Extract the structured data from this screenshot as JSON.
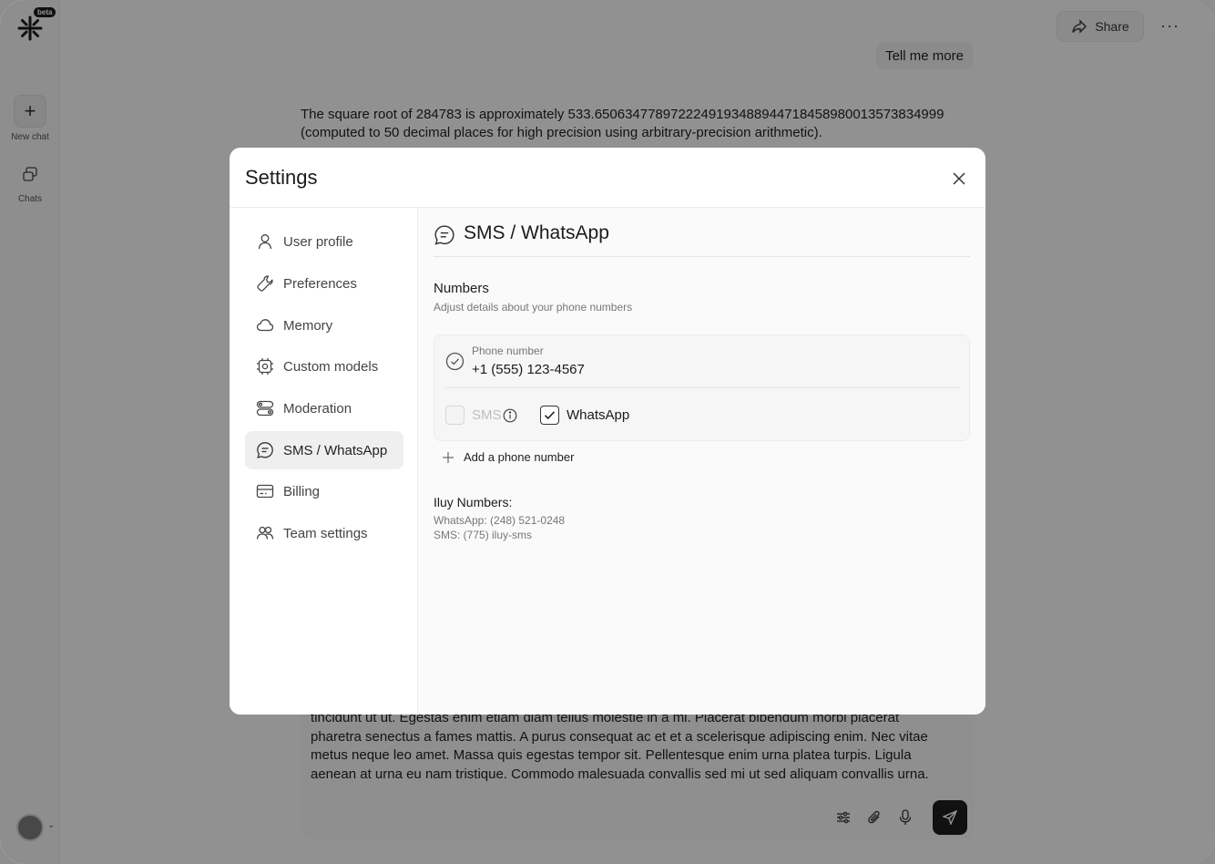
{
  "app": {
    "badge": "beta",
    "rail": {
      "new_chat": "New chat",
      "chats": "Chats"
    },
    "header": {
      "share": "Share"
    },
    "user_message": "Tell me more",
    "assistant_answer": "The square root of 284783 is approximately 533.65063477897222491934889447184589800135738349​99 (computed to 50 decimal places for high precision using arbitrary-precision arithmetic).",
    "composer_text": "tincidunt ut ut. Egestas enim etiam diam tellus molestie in a mi. Placerat bibendum morbi placerat pharetra senectus a fames mattis. A purus consequat ac et et a scelerisque adipiscing enim. Nec vitae metus neque leo amet. Massa quis egestas tempor sit. Pellentesque enim urna platea turpis. Ligula aenean at urna eu nam tristique. Commodo malesuada convallis sed mi ut sed aliquam convallis urna."
  },
  "modal": {
    "title": "Settings",
    "nav": [
      {
        "label": "User profile",
        "icon": "user-icon"
      },
      {
        "label": "Preferences",
        "icon": "wrench-icon"
      },
      {
        "label": "Memory",
        "icon": "cloud-icon"
      },
      {
        "label": "Custom models",
        "icon": "chip-icon"
      },
      {
        "label": "Moderation",
        "icon": "toggles-icon"
      },
      {
        "label": "SMS / WhatsApp",
        "icon": "chat-bubble-icon",
        "active": true
      },
      {
        "label": "Billing",
        "icon": "credit-card-icon"
      },
      {
        "label": "Team settings",
        "icon": "team-icon"
      }
    ],
    "content": {
      "title": "SMS / WhatsApp",
      "section_title": "Numbers",
      "section_subtitle": "Adjust details about your phone numbers",
      "phone": {
        "label": "Phone number",
        "value": "+1 (555) 123-4567",
        "sms_label": "SMS",
        "sms_checked": false,
        "whatsapp_label": "WhatsApp",
        "whatsapp_checked": true
      },
      "add_phone": "Add a phone number",
      "iluy_title": "Iluy Numbers:",
      "iluy_whatsapp": "WhatsApp: (248) 521-0248",
      "iluy_sms": "SMS: (775) iluy-sms"
    }
  }
}
